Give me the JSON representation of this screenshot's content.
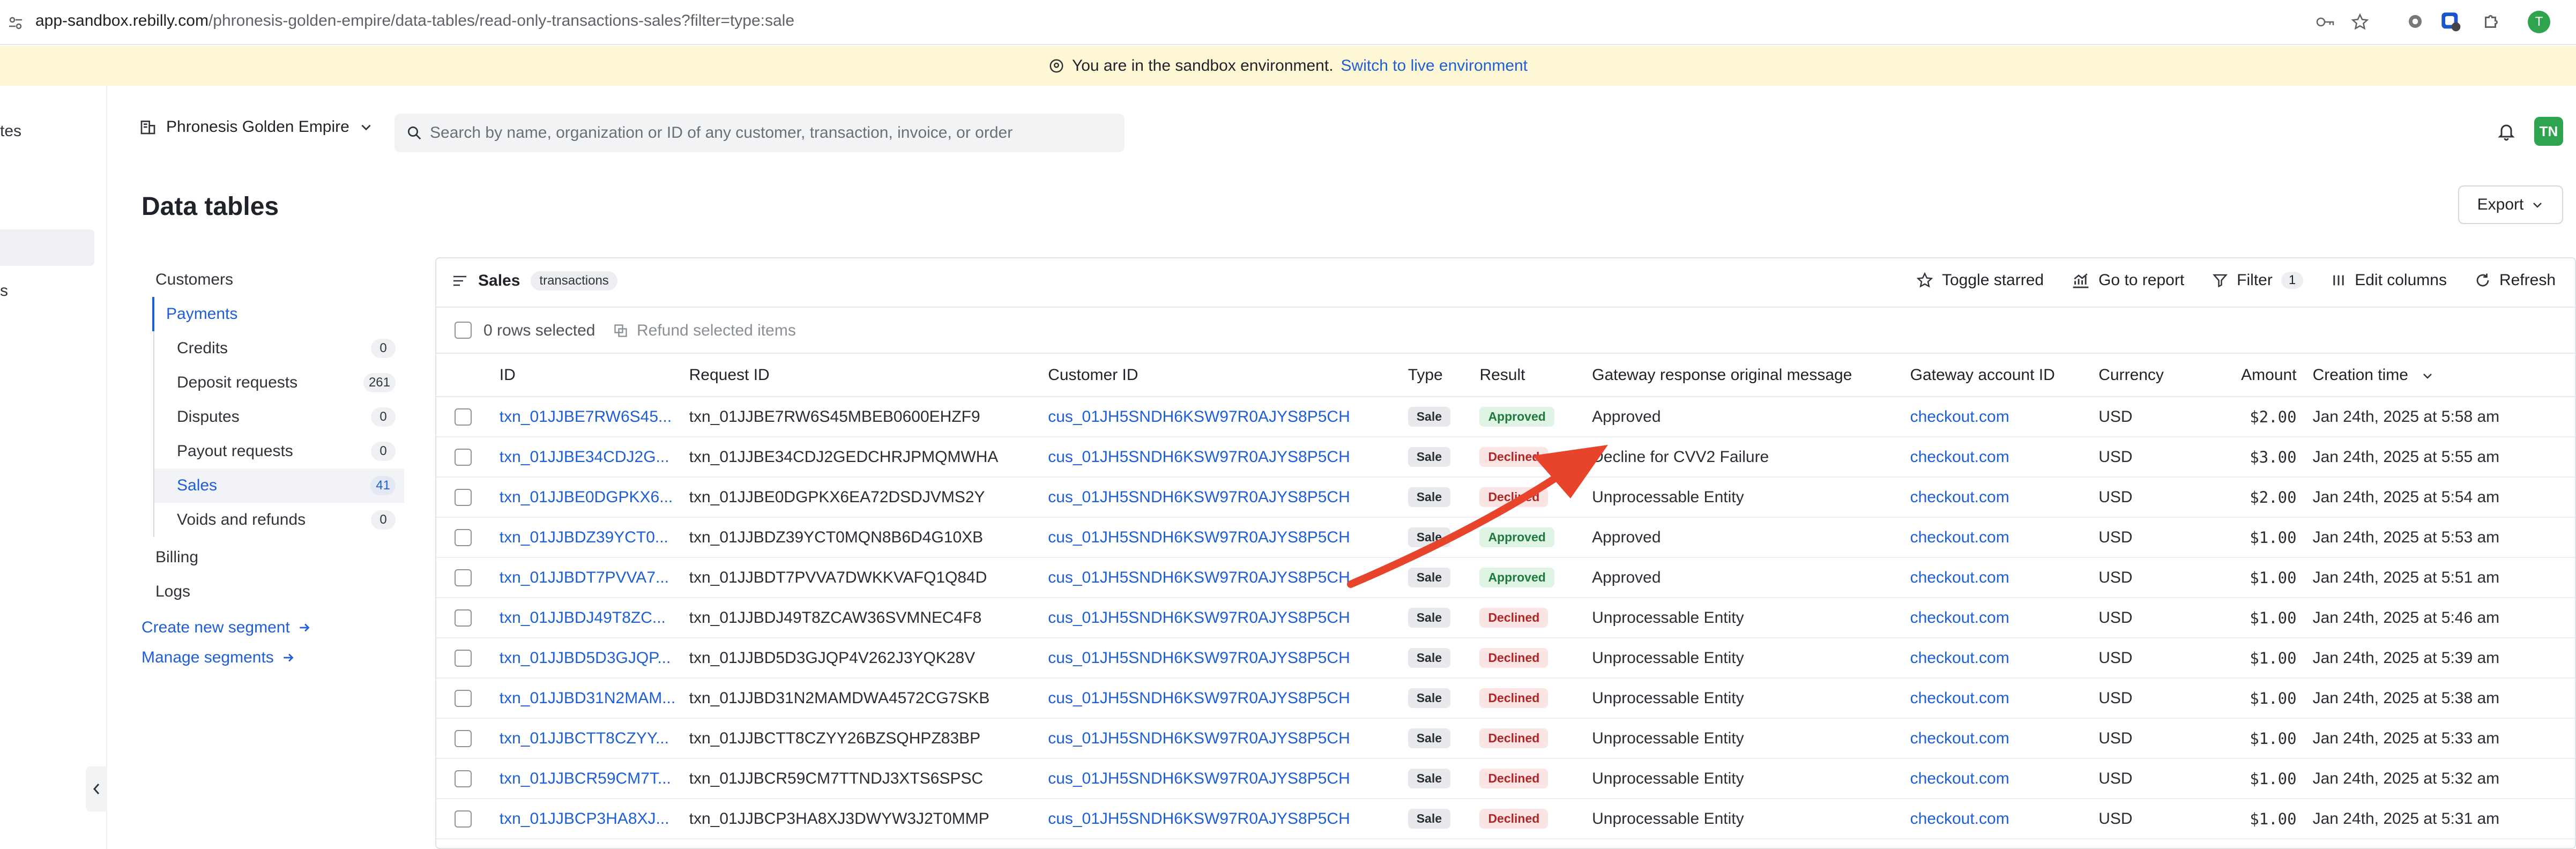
{
  "browser": {
    "url_host": "app-sandbox.rebilly.com",
    "url_path": "/phronesis-golden-empire/data-tables/read-only-transactions-sales?filter=type:sale",
    "avatar_letter": "T"
  },
  "banner": {
    "text": "You are in the sandbox environment.",
    "link": "Switch to live environment"
  },
  "left_nav": {
    "partial_1": "tes",
    "partial_2": "s"
  },
  "header": {
    "org_name": "Phronesis Golden Empire",
    "search_placeholder": "Search by name, organization or ID of any customer, transaction, invoice, or order",
    "user_initials": "TN",
    "colors": {
      "accent": "#1e5fd6",
      "avatar_bg": "#2ea44f"
    }
  },
  "page": {
    "title": "Data tables",
    "export_label": "Export"
  },
  "segments": {
    "customers": "Customers",
    "payments": "Payments",
    "items": [
      {
        "label": "Credits",
        "count": "0"
      },
      {
        "label": "Deposit requests",
        "count": "261"
      },
      {
        "label": "Disputes",
        "count": "0"
      },
      {
        "label": "Payout requests",
        "count": "0"
      },
      {
        "label": "Sales",
        "count": "41"
      },
      {
        "label": "Voids and refunds",
        "count": "0"
      }
    ],
    "billing": "Billing",
    "logs": "Logs",
    "create_segment": "Create new segment",
    "manage_segments": "Manage segments"
  },
  "table": {
    "title": "Sales",
    "tag": "transactions",
    "toggle_starred": "Toggle starred",
    "go_to_report": "Go to report",
    "filter": "Filter",
    "filter_count": "1",
    "edit_columns": "Edit columns",
    "refresh": "Refresh",
    "rows_selected": "0 rows selected",
    "refund_selected": "Refund selected items",
    "columns": [
      "ID",
      "Request ID",
      "Customer ID",
      "Type",
      "Result",
      "Gateway response original message",
      "Gateway account ID",
      "Currency",
      "Amount",
      "Creation time"
    ],
    "rows": [
      {
        "id": "txn_01JJBE7RW6S45...",
        "request_id": "txn_01JJBE7RW6S45MBEB0600EHZF9",
        "customer_id": "cus_01JH5SNDH6KSW97R0AJYS8P5CH",
        "type": "Sale",
        "result": "Approved",
        "message": "Approved",
        "gateway": "checkout.com",
        "currency": "USD",
        "amount": "$2.00",
        "created": "Jan 24th, 2025 at 5:58 am"
      },
      {
        "id": "txn_01JJBE34CDJ2G...",
        "request_id": "txn_01JJBE34CDJ2GEDCHRJPMQMWHA",
        "customer_id": "cus_01JH5SNDH6KSW97R0AJYS8P5CH",
        "type": "Sale",
        "result": "Declined",
        "message": "Decline for CVV2 Failure",
        "gateway": "checkout.com",
        "currency": "USD",
        "amount": "$3.00",
        "created": "Jan 24th, 2025 at 5:55 am"
      },
      {
        "id": "txn_01JJBE0DGPKX6...",
        "request_id": "txn_01JJBE0DGPKX6EA72DSDJVMS2Y",
        "customer_id": "cus_01JH5SNDH6KSW97R0AJYS8P5CH",
        "type": "Sale",
        "result": "Declined",
        "message": "Unprocessable Entity",
        "gateway": "checkout.com",
        "currency": "USD",
        "amount": "$2.00",
        "created": "Jan 24th, 2025 at 5:54 am"
      },
      {
        "id": "txn_01JJBDZ39YCT0...",
        "request_id": "txn_01JJBDZ39YCT0MQN8B6D4G10XB",
        "customer_id": "cus_01JH5SNDH6KSW97R0AJYS8P5CH",
        "type": "Sale",
        "result": "Approved",
        "message": "Approved",
        "gateway": "checkout.com",
        "currency": "USD",
        "amount": "$1.00",
        "created": "Jan 24th, 2025 at 5:53 am"
      },
      {
        "id": "txn_01JJBDT7PVVA7...",
        "request_id": "txn_01JJBDT7PVVA7DWKKVAFQ1Q84D",
        "customer_id": "cus_01JH5SNDH6KSW97R0AJYS8P5CH",
        "type": "Sale",
        "result": "Approved",
        "message": "Approved",
        "gateway": "checkout.com",
        "currency": "USD",
        "amount": "$1.00",
        "created": "Jan 24th, 2025 at 5:51 am"
      },
      {
        "id": "txn_01JJBDJ49T8ZC...",
        "request_id": "txn_01JJBDJ49T8ZCAW36SVMNEC4F8",
        "customer_id": "cus_01JH5SNDH6KSW97R0AJYS8P5CH",
        "type": "Sale",
        "result": "Declined",
        "message": "Unprocessable Entity",
        "gateway": "checkout.com",
        "currency": "USD",
        "amount": "$1.00",
        "created": "Jan 24th, 2025 at 5:46 am"
      },
      {
        "id": "txn_01JJBD5D3GJQP...",
        "request_id": "txn_01JJBD5D3GJQP4V262J3YQK28V",
        "customer_id": "cus_01JH5SNDH6KSW97R0AJYS8P5CH",
        "type": "Sale",
        "result": "Declined",
        "message": "Unprocessable Entity",
        "gateway": "checkout.com",
        "currency": "USD",
        "amount": "$1.00",
        "created": "Jan 24th, 2025 at 5:39 am"
      },
      {
        "id": "txn_01JJBD31N2MAM...",
        "request_id": "txn_01JJBD31N2MAMDWA4572CG7SKB",
        "customer_id": "cus_01JH5SNDH6KSW97R0AJYS8P5CH",
        "type": "Sale",
        "result": "Declined",
        "message": "Unprocessable Entity",
        "gateway": "checkout.com",
        "currency": "USD",
        "amount": "$1.00",
        "created": "Jan 24th, 2025 at 5:38 am"
      },
      {
        "id": "txn_01JJBCTT8CZYY...",
        "request_id": "txn_01JJBCTT8CZYY26BZSQHPZ83BP",
        "customer_id": "cus_01JH5SNDH6KSW97R0AJYS8P5CH",
        "type": "Sale",
        "result": "Declined",
        "message": "Unprocessable Entity",
        "gateway": "checkout.com",
        "currency": "USD",
        "amount": "$1.00",
        "created": "Jan 24th, 2025 at 5:33 am"
      },
      {
        "id": "txn_01JJBCR59CM7T...",
        "request_id": "txn_01JJBCR59CM7TTNDJ3XTS6SPSC",
        "customer_id": "cus_01JH5SNDH6KSW97R0AJYS8P5CH",
        "type": "Sale",
        "result": "Declined",
        "message": "Unprocessable Entity",
        "gateway": "checkout.com",
        "currency": "USD",
        "amount": "$1.00",
        "created": "Jan 24th, 2025 at 5:32 am"
      },
      {
        "id": "txn_01JJBCP3HA8XJ...",
        "request_id": "txn_01JJBCP3HA8XJ3DWYW3J2T0MMP",
        "customer_id": "cus_01JH5SNDH6KSW97R0AJYS8P5CH",
        "type": "Sale",
        "result": "Declined",
        "message": "Unprocessable Entity",
        "gateway": "checkout.com",
        "currency": "USD",
        "amount": "$1.00",
        "created": "Jan 24th, 2025 at 5:31 am"
      }
    ]
  }
}
